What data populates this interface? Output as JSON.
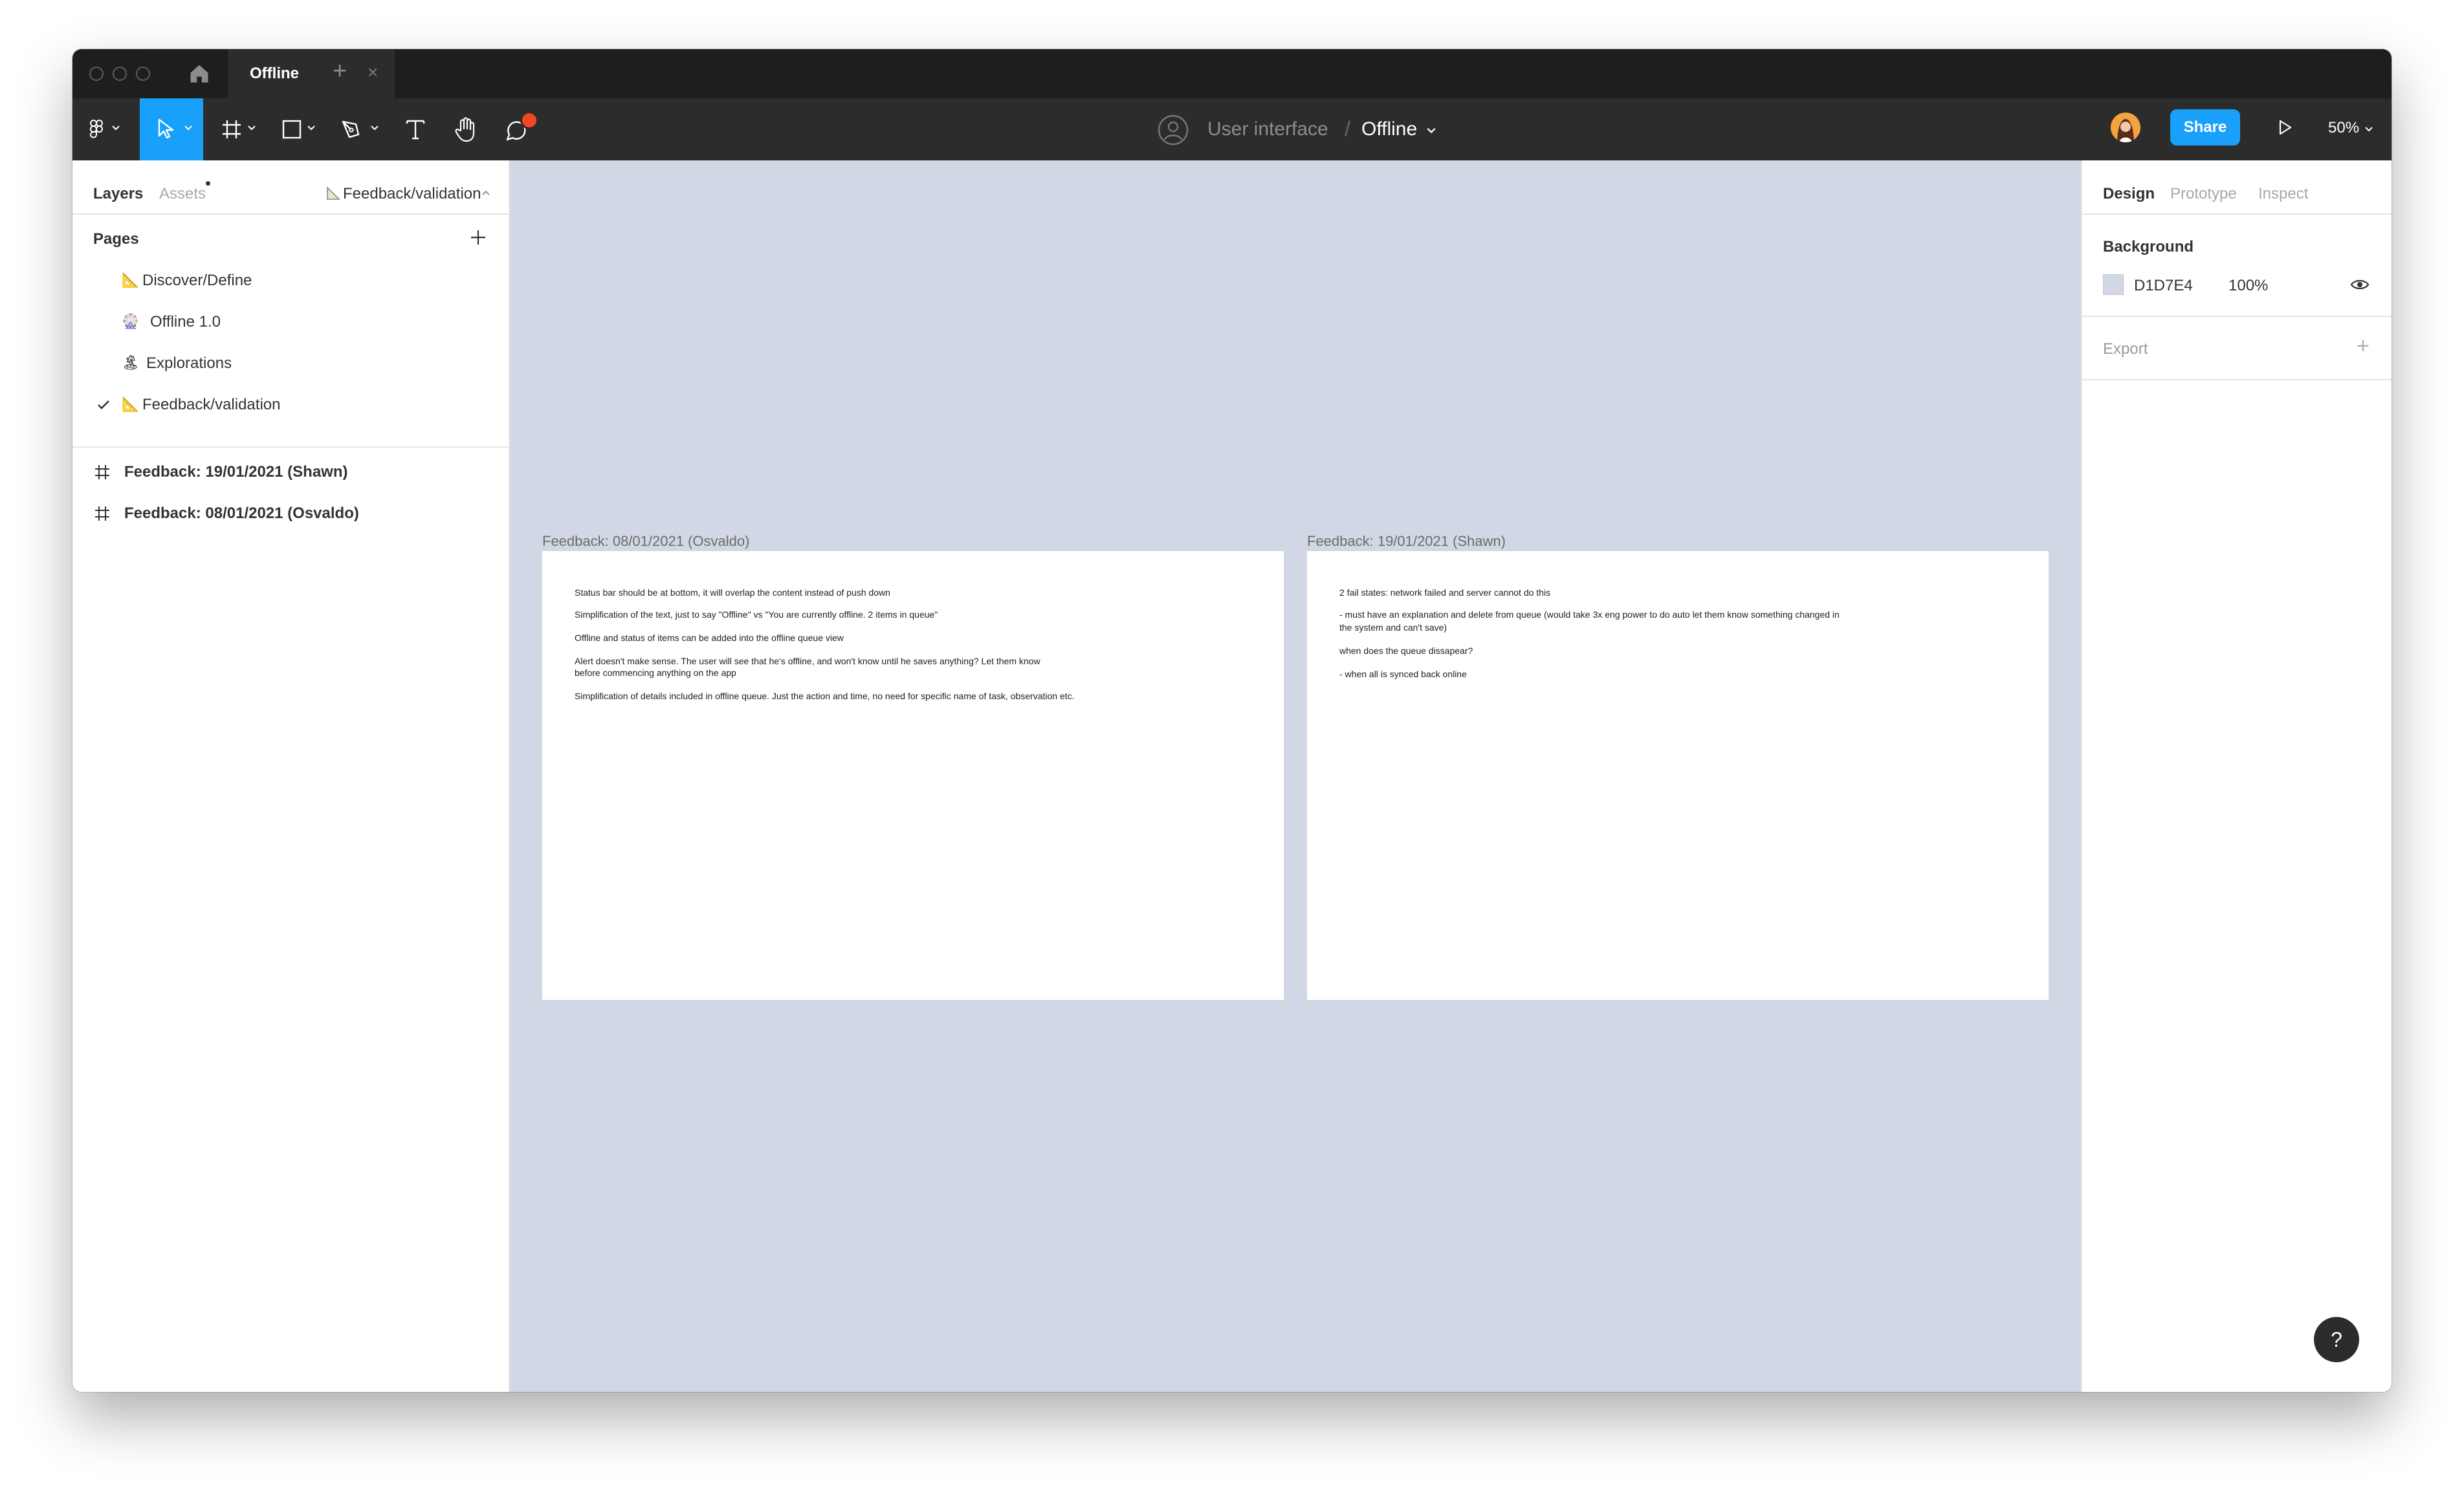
{
  "tabbar": {
    "active_tab": "Offline",
    "close_glyph": "×",
    "new_tab_glyph": "+"
  },
  "toolbar": {
    "project": "User interface",
    "separator": "/",
    "file_name": "Offline",
    "share_label": "Share",
    "zoom": "50%",
    "accent_color": "#18a0fb",
    "notification_color": "#f24822"
  },
  "left_panel": {
    "tabs": {
      "layers": "Layers",
      "assets": "Assets",
      "current_page": "Feedback/validation"
    },
    "pages_title": "Pages",
    "pages": [
      {
        "icon": "📐",
        "label": "Discover/Define",
        "selected": false
      },
      {
        "icon": "🎡",
        "label": "Offline 1.0",
        "selected": false
      },
      {
        "icon": "🏝",
        "label": "Explorations",
        "selected": false
      },
      {
        "icon": "📐",
        "label": "Feedback/validation",
        "selected": true
      }
    ],
    "layers": [
      {
        "icon": "frame-icon",
        "label": "Feedback: 19/01/2021 (Shawn)"
      },
      {
        "icon": "frame-icon",
        "label": "Feedback: 08/01/2021 (Osvaldo)"
      }
    ]
  },
  "canvas": {
    "background": "#d1d7e4",
    "frames": [
      {
        "label": "Feedback: 08/01/2021 (Osvaldo)",
        "notes": [
          "Status bar should be at bottom, it will overlap the content instead of push down",
          "Simplification of the text, just to say \"Offline\" vs \"You are currently offline. 2 items in queue\"",
          "Offline and status of items can be added into the offline queue view",
          "Alert doesn't make sense. The user will see that he's offline, and won't know until he saves anything? Let them know",
          "before commencing anything on the app",
          "Simplification of details included in offline queue. Just the action and time, no need for specific name of task, observation etc."
        ]
      },
      {
        "label": "Feedback: 19/01/2021 (Shawn)",
        "notes": [
          "2 fail states: network failed and server cannot do this",
          "- must have an explanation and delete from queue (would take 3x eng power to do auto let them know something changed in",
          "the system and can't save)",
          "when does the queue dissapear?",
          "- when all is synced back online"
        ]
      }
    ]
  },
  "right_panel": {
    "tabs": {
      "design": "Design",
      "prototype": "Prototype",
      "inspect": "Inspect"
    },
    "background_title": "Background",
    "background_hex": "D1D7E4",
    "background_opacity": "100%",
    "export_title": "Export",
    "export_add": "+"
  },
  "help": {
    "label": "?"
  }
}
